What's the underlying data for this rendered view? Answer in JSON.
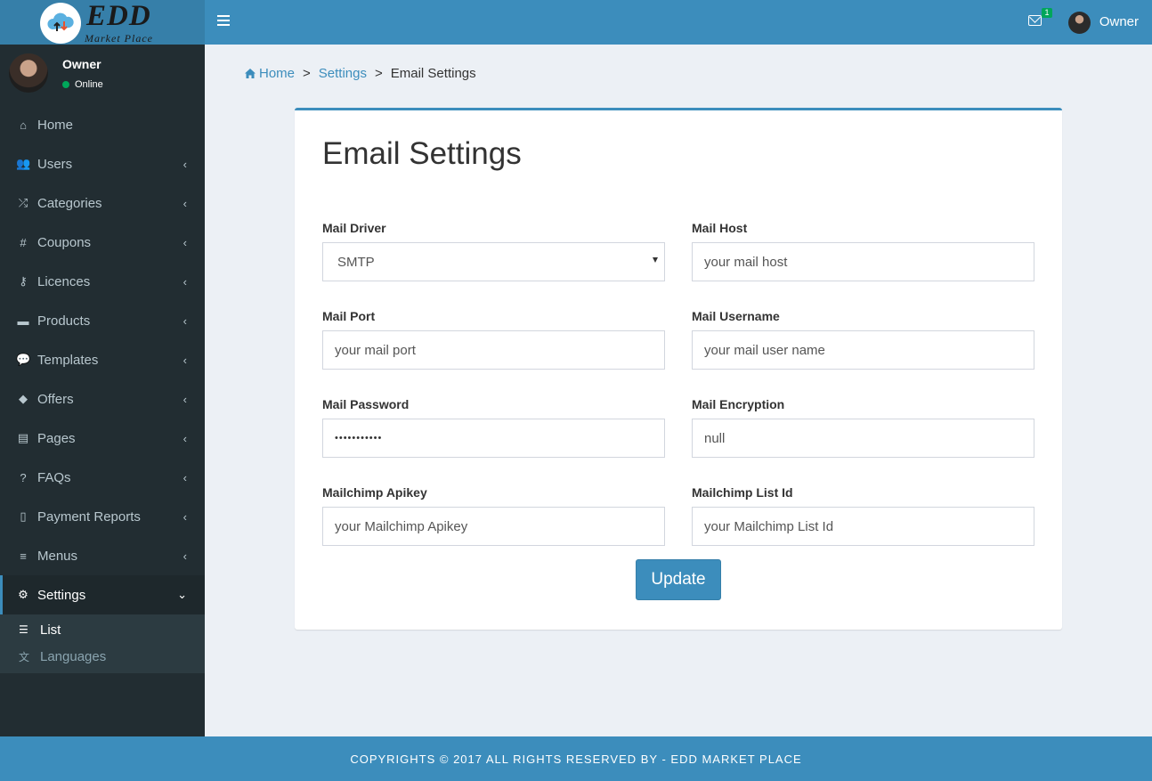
{
  "brand": {
    "name": "EDD",
    "tagline": "Market Place"
  },
  "header": {
    "mail_badge": "1",
    "user_name": "Owner"
  },
  "sidebar": {
    "user": {
      "name": "Owner",
      "status": "Online"
    },
    "items": [
      {
        "label": "Home",
        "icon": "home-icon",
        "glyph": "⌂",
        "chevron": false
      },
      {
        "label": "Users",
        "icon": "users-icon",
        "glyph": "👥",
        "chevron": true
      },
      {
        "label": "Categories",
        "icon": "shuffle-icon",
        "glyph": "⤮",
        "chevron": true
      },
      {
        "label": "Coupons",
        "icon": "hashtag-icon",
        "glyph": "#",
        "chevron": true
      },
      {
        "label": "Licences",
        "icon": "key-icon",
        "glyph": "⚷",
        "chevron": true
      },
      {
        "label": "Products",
        "icon": "shopping-bag-icon",
        "glyph": "▬",
        "chevron": true
      },
      {
        "label": "Templates",
        "icon": "comment-icon",
        "glyph": "💬",
        "chevron": true
      },
      {
        "label": "Offers",
        "icon": "tags-icon",
        "glyph": "◆",
        "chevron": true
      },
      {
        "label": "Pages",
        "icon": "file-text-icon",
        "glyph": "▤",
        "chevron": true
      },
      {
        "label": "FAQs",
        "icon": "question-icon",
        "glyph": "?",
        "chevron": true
      },
      {
        "label": "Payment Reports",
        "icon": "file-icon",
        "glyph": "▯",
        "chevron": true
      },
      {
        "label": "Menus",
        "icon": "bars-icon",
        "glyph": "≡",
        "chevron": true
      },
      {
        "label": "Settings",
        "icon": "cog-icon",
        "glyph": "⚙",
        "chevron": true,
        "active": true
      }
    ],
    "submenu": [
      {
        "label": "List",
        "icon": "list-icon",
        "glyph": "☰",
        "current": true
      },
      {
        "label": "Languages",
        "icon": "language-icon",
        "glyph": "文",
        "current": false
      }
    ]
  },
  "breadcrumb": {
    "home": "Home",
    "settings": "Settings",
    "current": "Email Settings",
    "separator": ">"
  },
  "form": {
    "title": "Email Settings",
    "fields": {
      "mail_driver": {
        "label": "Mail Driver",
        "value": "SMTP"
      },
      "mail_host": {
        "label": "Mail Host",
        "placeholder": "your mail host"
      },
      "mail_port": {
        "label": "Mail Port",
        "placeholder": "your mail port"
      },
      "mail_username": {
        "label": "Mail Username",
        "placeholder": "your mail user name"
      },
      "mail_password": {
        "label": "Mail Password",
        "value": "•••••••••••"
      },
      "mail_encryption": {
        "label": "Mail Encryption",
        "value": "null"
      },
      "mailchimp_apikey": {
        "label": "Mailchimp Apikey",
        "placeholder": "your Mailchimp Apikey"
      },
      "mailchimp_list_id": {
        "label": "Mailchimp List Id",
        "placeholder": "your Mailchimp List Id"
      }
    },
    "submit_label": "Update"
  },
  "footer": {
    "text": "COPYRIGHTS © 2017 ALL RIGHTS RESERVED BY - EDD MARKET PLACE"
  },
  "colors": {
    "primary": "#3c8dbc",
    "primary_dark": "#367fa9",
    "sidebar_bg": "#222d32",
    "content_bg": "#ecf0f5",
    "online": "#00a65a"
  }
}
